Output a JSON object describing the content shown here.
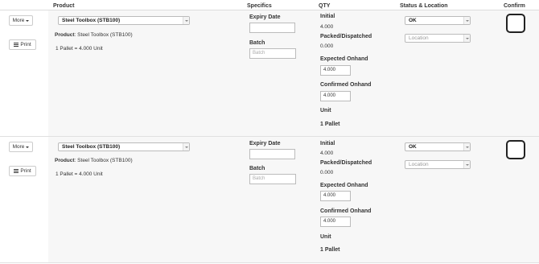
{
  "header": {
    "product": "Product",
    "specifics": "Specifics",
    "qty": "QTY",
    "status_location": "Status & Location",
    "confirm": "Confirm"
  },
  "rows": [
    {
      "more_label": "More",
      "print_label": "Print",
      "product_select": "Steel Toolbox (STB100)",
      "product_label": "Product",
      "product_value": ": Steel Toolbox (STB100)",
      "pallet_info": "1 Pallet = 4.000 Unit",
      "expiry_label": "Expiry Date",
      "expiry_value": "",
      "batch_label": "Batch",
      "batch_placeholder": "Batch",
      "initial_label": "Initial",
      "initial_value": "4.000",
      "packed_label": "Packed/Dispatched",
      "packed_value": "0.000",
      "expected_label": "Expected Onhand",
      "expected_value": "4.000",
      "confirmed_label": "Confirmed Onhand",
      "confirmed_value": "4.000",
      "unit_label": "Unit",
      "pallet_label": "1 Pallet",
      "status_value": "OK",
      "location_placeholder": "Location",
      "confirmed": false
    },
    {
      "more_label": "More",
      "print_label": "Print",
      "product_select": "Steel Toolbox (STB100)",
      "product_label": "Product",
      "product_value": ": Steel Toolbox (STB100)",
      "pallet_info": "1 Pallet = 4.000 Unit",
      "expiry_label": "Expiry Date",
      "expiry_value": "",
      "batch_label": "Batch",
      "batch_placeholder": "Batch",
      "initial_label": "Initial",
      "initial_value": "4.000",
      "packed_label": "Packed/Dispatched",
      "packed_value": "0.000",
      "expected_label": "Expected Onhand",
      "expected_value": "4.000",
      "confirmed_label": "Confirmed Onhand",
      "confirmed_value": "4.000",
      "unit_label": "Unit",
      "pallet_label": "1 Pallet",
      "status_value": "OK",
      "location_placeholder": "Location",
      "confirmed": false
    }
  ]
}
